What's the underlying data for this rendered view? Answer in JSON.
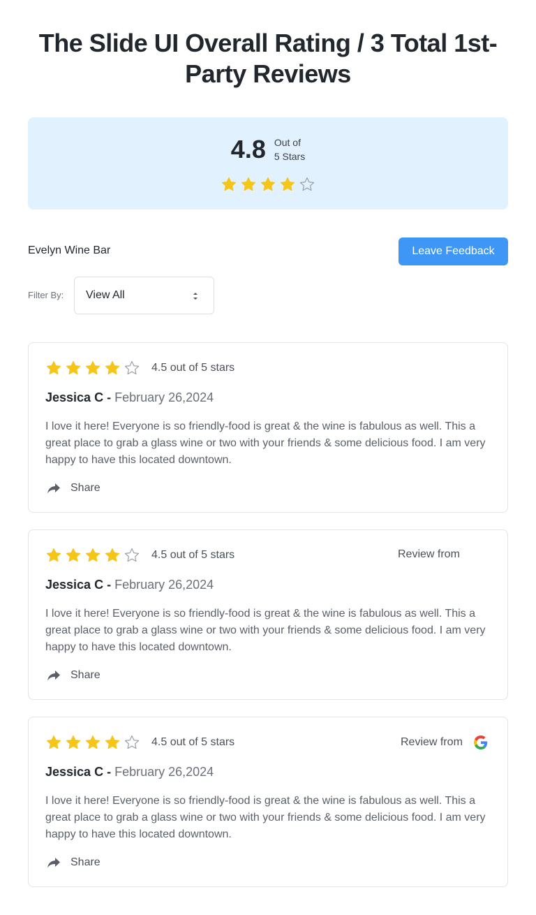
{
  "page": {
    "title": "The Slide UI Overall Rating / 3 Total 1st-Party Reviews"
  },
  "summary": {
    "score": "4.8",
    "outof_line1": "Out of",
    "outof_line2": "5 Stars",
    "stars": {
      "filled": 4,
      "total": 5
    }
  },
  "business": {
    "name": "Evelyn Wine Bar",
    "leave_feedback_label": "Leave Feedback"
  },
  "filter": {
    "label": "Filter By:",
    "selected": "View All"
  },
  "reviews": [
    {
      "rating_text": "4.5 out of 5 stars",
      "stars": {
        "filled": 4,
        "total": 5
      },
      "review_from": "",
      "source_icon": "",
      "author": "Jessica C -",
      "date": "February 26,2024",
      "body": "I love it here! Everyone is so friendly-food is great & the wine is fabulous as well. This a great place to grab a glass wine or two with your friends & some delicious food. I am very happy to have this located downtown.",
      "share_label": "Share"
    },
    {
      "rating_text": "4.5 out of 5 stars",
      "stars": {
        "filled": 4,
        "total": 5
      },
      "review_from": "Review from",
      "source_icon": "",
      "author": "Jessica C -",
      "date": "February 26,2024",
      "body": "I love it here! Everyone is so friendly-food is great & the wine is fabulous as well. This a great place to grab a glass wine or two with your friends & some delicious food. I am very happy to have this located downtown.",
      "share_label": "Share"
    },
    {
      "rating_text": "4.5 out of 5 stars",
      "stars": {
        "filled": 4,
        "total": 5
      },
      "review_from": "Review from",
      "source_icon": "google-icon",
      "author": "Jessica C -",
      "date": "February 26,2024",
      "body": "I love it here! Everyone is so friendly-food is great & the wine is fabulous as well. This a great place to grab a glass wine or two with your friends & some delicious food. I am very happy to have this located downtown.",
      "share_label": "Share"
    }
  ],
  "colors": {
    "star_filled": "#f5c518",
    "star_empty": "#9aa0a8",
    "accent": "#3f97f5",
    "summary_bg": "#e1f1fd"
  }
}
